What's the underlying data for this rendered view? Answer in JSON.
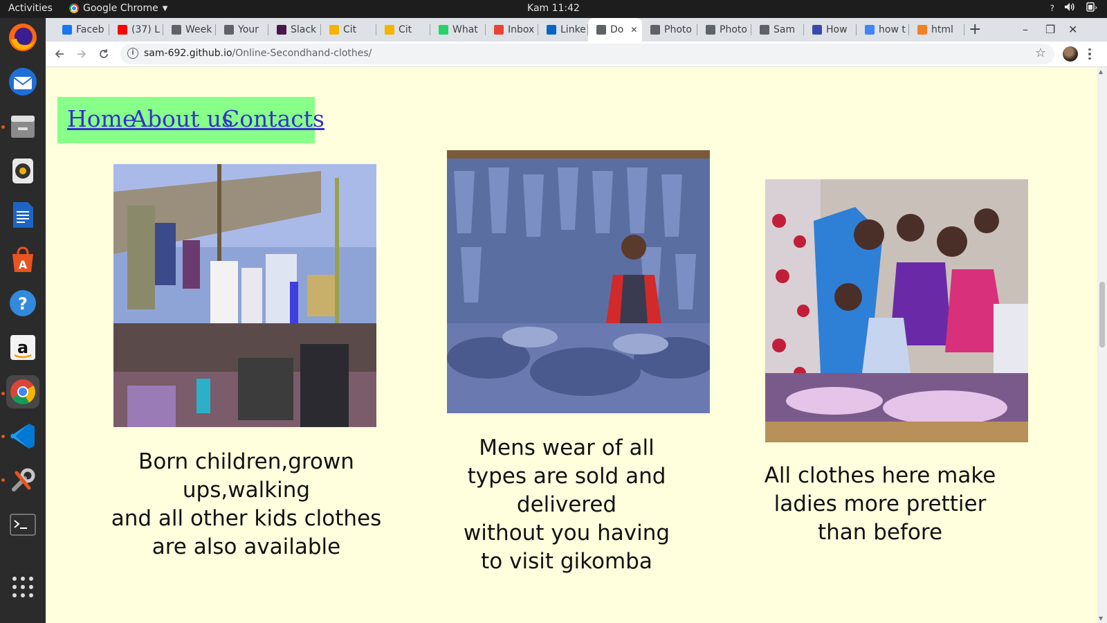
{
  "system": {
    "activities_label": "Activities",
    "app_name": "Google Chrome",
    "clock": "Kam 11:42",
    "tray_help": "?"
  },
  "dock": {
    "apps": [
      "firefox-icon",
      "thunderbird-icon",
      "files-icon",
      "rhythmbox-icon",
      "writer-icon",
      "software-icon",
      "help-icon",
      "amazon-icon",
      "chrome-icon",
      "vscode-icon",
      "settings-icon",
      "terminal-icon"
    ],
    "show_apps": "show-apps-icon"
  },
  "browser": {
    "tabs": [
      {
        "label": "Faceb",
        "icon": "facebook-icon",
        "color": "#1877f2"
      },
      {
        "label": "(37) L",
        "icon": "youtube-icon",
        "color": "#ff0000"
      },
      {
        "label": "Week",
        "icon": "week-icon",
        "color": "#5f6368"
      },
      {
        "label": "Your",
        "icon": "web-icon",
        "color": "#5f6368"
      },
      {
        "label": "Slack",
        "icon": "slack-icon",
        "color": "#4a154b"
      },
      {
        "label": "Cit",
        "icon": "cit-icon",
        "color": "#f4b400"
      },
      {
        "label": "Cit",
        "icon": "cit-icon",
        "color": "#f4b400"
      },
      {
        "label": "What",
        "icon": "whatsapp-icon",
        "color": "#25d366"
      },
      {
        "label": "Inbox",
        "icon": "gmail-icon",
        "color": "#ea4335"
      },
      {
        "label": "Linke",
        "icon": "linkedin-icon",
        "color": "#0a66c2"
      },
      {
        "label": "Do",
        "icon": "web-icon",
        "color": "#5f6368",
        "active": true
      },
      {
        "label": "Photo",
        "icon": "photopea-icon",
        "color": "#5f6368"
      },
      {
        "label": "Photo",
        "icon": "photopea-icon",
        "color": "#5f6368"
      },
      {
        "label": "Sam",
        "icon": "web-icon",
        "color": "#5f6368"
      },
      {
        "label": "How",
        "icon": "how-icon",
        "color": "#3949ab"
      },
      {
        "label": "how t",
        "icon": "google-icon",
        "color": "#4285f4"
      },
      {
        "label": "html",
        "icon": "stackoverflow-icon",
        "color": "#f48024"
      }
    ],
    "url_host": "sam-692.github.io",
    "url_path": "/Online-Secondhand-clothes/"
  },
  "page": {
    "nav": {
      "home": "Home",
      "about": "About us",
      "contacts": "Contacts"
    },
    "items": [
      {
        "image": "kids-market-photo",
        "caption_lines": [
          "Born children,grown",
          "ups,walking",
          "and all other kids clothes",
          "are also available"
        ]
      },
      {
        "image": "mens-jeans-photo",
        "caption_lines": [
          "Mens wear of all",
          "types are sold and",
          "delivered",
          "without you having",
          "to visit gikomba"
        ]
      },
      {
        "image": "ladies-clothes-photo",
        "caption_lines": [
          "All clothes here make",
          "ladies more prettier",
          "than before"
        ]
      }
    ]
  }
}
